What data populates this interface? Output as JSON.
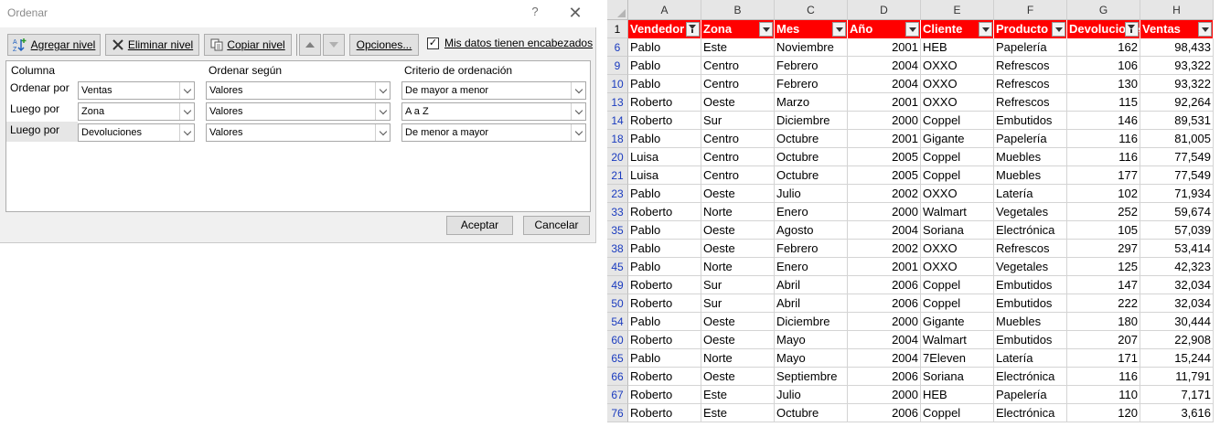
{
  "dialog": {
    "title": "Ordenar",
    "help": "?",
    "close": "✕",
    "toolbar": {
      "add_level": "Agregar nivel",
      "delete_level": "Eliminar nivel",
      "copy_level": "Copiar nivel",
      "options": "Opciones...",
      "headers_checkbox": "Mis datos tienen encabezados",
      "headers_checked": true
    },
    "columns": {
      "col1": "Columna",
      "col2": "Ordenar según",
      "col3": "Criterio de ordenación"
    },
    "levels": [
      {
        "label": "Ordenar por",
        "column": "Ventas",
        "sort_on": "Valores",
        "order": "De mayor a menor",
        "selected": false
      },
      {
        "label": "Luego por",
        "column": "Zona",
        "sort_on": "Valores",
        "order": "A a Z",
        "selected": false
      },
      {
        "label": "Luego por",
        "column": "Devoluciones",
        "sort_on": "Valores",
        "order": "De menor a mayor",
        "selected": true
      }
    ],
    "ok": "Aceptar",
    "cancel": "Cancelar"
  },
  "sheet": {
    "col_letters": [
      "A",
      "B",
      "C",
      "D",
      "E",
      "F",
      "G",
      "H"
    ],
    "header_row_number": "1",
    "headers": [
      "Vendedor",
      "Zona",
      "Mes",
      "Año",
      "Cliente",
      "Producto",
      "Devoluciones",
      "Ventas"
    ],
    "header_fill": "#ff0000",
    "rows": [
      {
        "n": "6",
        "cells": [
          "Pablo",
          "Este",
          "Noviembre",
          "2001",
          "HEB",
          "Papelería",
          "162",
          "98,433"
        ]
      },
      {
        "n": "9",
        "cells": [
          "Pablo",
          "Centro",
          "Febrero",
          "2004",
          "OXXO",
          "Refrescos",
          "106",
          "93,322"
        ]
      },
      {
        "n": "10",
        "cells": [
          "Pablo",
          "Centro",
          "Febrero",
          "2004",
          "OXXO",
          "Refrescos",
          "130",
          "93,322"
        ]
      },
      {
        "n": "13",
        "cells": [
          "Roberto",
          "Oeste",
          "Marzo",
          "2001",
          "OXXO",
          "Refrescos",
          "115",
          "92,264"
        ]
      },
      {
        "n": "14",
        "cells": [
          "Roberto",
          "Sur",
          "Diciembre",
          "2000",
          "Coppel",
          "Embutidos",
          "146",
          "89,531"
        ]
      },
      {
        "n": "18",
        "cells": [
          "Pablo",
          "Centro",
          "Octubre",
          "2001",
          "Gigante",
          "Papelería",
          "116",
          "81,005"
        ]
      },
      {
        "n": "20",
        "cells": [
          "Luisa",
          "Centro",
          "Octubre",
          "2005",
          "Coppel",
          "Muebles",
          "116",
          "77,549"
        ]
      },
      {
        "n": "21",
        "cells": [
          "Luisa",
          "Centro",
          "Octubre",
          "2005",
          "Coppel",
          "Muebles",
          "177",
          "77,549"
        ]
      },
      {
        "n": "23",
        "cells": [
          "Pablo",
          "Oeste",
          "Julio",
          "2002",
          "OXXO",
          "Latería",
          "102",
          "71,934"
        ]
      },
      {
        "n": "33",
        "cells": [
          "Roberto",
          "Norte",
          "Enero",
          "2000",
          "Walmart",
          "Vegetales",
          "252",
          "59,674"
        ]
      },
      {
        "n": "35",
        "cells": [
          "Pablo",
          "Oeste",
          "Agosto",
          "2004",
          "Soriana",
          "Electrónica",
          "105",
          "57,039"
        ]
      },
      {
        "n": "38",
        "cells": [
          "Pablo",
          "Oeste",
          "Febrero",
          "2002",
          "OXXO",
          "Refrescos",
          "297",
          "53,414"
        ]
      },
      {
        "n": "45",
        "cells": [
          "Pablo",
          "Norte",
          "Enero",
          "2001",
          "OXXO",
          "Vegetales",
          "125",
          "42,323"
        ]
      },
      {
        "n": "49",
        "cells": [
          "Roberto",
          "Sur",
          "Abril",
          "2006",
          "Coppel",
          "Embutidos",
          "147",
          "32,034"
        ]
      },
      {
        "n": "50",
        "cells": [
          "Roberto",
          "Sur",
          "Abril",
          "2006",
          "Coppel",
          "Embutidos",
          "222",
          "32,034"
        ]
      },
      {
        "n": "54",
        "cells": [
          "Pablo",
          "Oeste",
          "Diciembre",
          "2000",
          "Gigante",
          "Muebles",
          "180",
          "30,444"
        ]
      },
      {
        "n": "60",
        "cells": [
          "Roberto",
          "Oeste",
          "Mayo",
          "2004",
          "Walmart",
          "Embutidos",
          "207",
          "22,908"
        ]
      },
      {
        "n": "65",
        "cells": [
          "Pablo",
          "Norte",
          "Mayo",
          "2004",
          "7Eleven",
          "Latería",
          "171",
          "15,244"
        ]
      },
      {
        "n": "66",
        "cells": [
          "Roberto",
          "Oeste",
          "Septiembre",
          "2006",
          "Soriana",
          "Electrónica",
          "116",
          "11,791"
        ]
      },
      {
        "n": "67",
        "cells": [
          "Roberto",
          "Este",
          "Julio",
          "2000",
          "HEB",
          "Papelería",
          "110",
          "7,171"
        ]
      },
      {
        "n": "76",
        "cells": [
          "Roberto",
          "Este",
          "Octubre",
          "2006",
          "Coppel",
          "Electrónica",
          "120",
          "3,616"
        ]
      }
    ]
  }
}
